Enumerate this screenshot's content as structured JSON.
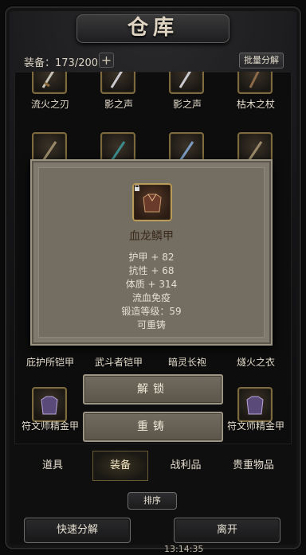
{
  "window": {
    "title": "仓库"
  },
  "header": {
    "capacity_label": "装备：173/200",
    "plus_symbol": "+",
    "batch_button": "批量分解"
  },
  "grid": {
    "row1_labels": [
      "流火之刃",
      "影之声",
      "影之声",
      "枯木之杖"
    ],
    "row3_labels": [
      "庇护所铠甲",
      "武斗者铠甲",
      "暗灵长袍",
      "燧火之衣"
    ],
    "row4_left_label": "符文师精金甲",
    "row4_right_label": "符文师精金甲"
  },
  "item_detail": {
    "name": "血龙鳞甲",
    "stats": [
      "护甲 + 82",
      "抗性 + 68",
      "体质 + 314",
      "流血免疫",
      "锻造等级：59",
      "可重铸"
    ]
  },
  "actions": {
    "dismantle": "解锁",
    "reforge": "重铸"
  },
  "tabs": {
    "items": [
      "道具",
      "装备",
      "战利品",
      "贵重物品"
    ],
    "active_index": 1
  },
  "sort_button": "排序",
  "bottom": {
    "quick_dismantle": "快速分解",
    "leave": "离开"
  },
  "status": {
    "time": "13:14:35"
  },
  "colors": {
    "slot_border": "#7d6a3e",
    "popup_bg": "#807a6e",
    "item_name": "#3a2a1c"
  },
  "icons": [
    "lock-icon",
    "sword-icon",
    "staff-icon",
    "armor-icon",
    "plus-icon"
  ]
}
